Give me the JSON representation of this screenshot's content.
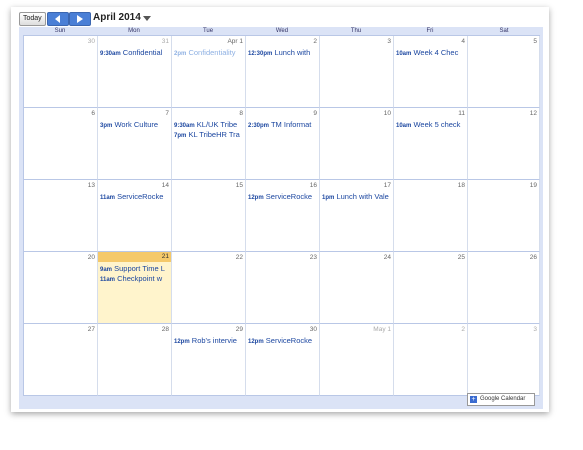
{
  "toolbar": {
    "today_label": "Today",
    "month_label": "April 2014"
  },
  "weekdays": [
    "Sun",
    "Mon",
    "Tue",
    "Wed",
    "Thu",
    "Fri",
    "Sat"
  ],
  "weeks": [
    [
      {
        "day": "30",
        "other": true,
        "events": []
      },
      {
        "day": "31",
        "other": true,
        "events": [
          {
            "time": "9:30am",
            "title": "Confidential"
          }
        ]
      },
      {
        "day": "Apr 1",
        "other": false,
        "events": [
          {
            "time": "2pm",
            "title": "Confidentiality",
            "faded": true
          }
        ]
      },
      {
        "day": "2",
        "other": false,
        "events": [
          {
            "time": "12:30pm",
            "title": "Lunch with"
          }
        ]
      },
      {
        "day": "3",
        "other": false,
        "events": []
      },
      {
        "day": "4",
        "other": false,
        "events": [
          {
            "time": "10am",
            "title": "Week 4 Chec"
          }
        ]
      },
      {
        "day": "5",
        "other": false,
        "events": []
      }
    ],
    [
      {
        "day": "6",
        "other": false,
        "events": []
      },
      {
        "day": "7",
        "other": false,
        "events": [
          {
            "time": "3pm",
            "title": "Work Culture"
          }
        ]
      },
      {
        "day": "8",
        "other": false,
        "events": [
          {
            "time": "9:30am",
            "title": "KL/UK Tribe"
          },
          {
            "time": "7pm",
            "title": "KL TribeHR Tra"
          }
        ]
      },
      {
        "day": "9",
        "other": false,
        "events": [
          {
            "time": "2:30pm",
            "title": "TM Informat"
          }
        ]
      },
      {
        "day": "10",
        "other": false,
        "events": []
      },
      {
        "day": "11",
        "other": false,
        "events": [
          {
            "time": "10am",
            "title": "Week 5 check"
          }
        ]
      },
      {
        "day": "12",
        "other": false,
        "events": []
      }
    ],
    [
      {
        "day": "13",
        "other": false,
        "events": []
      },
      {
        "day": "14",
        "other": false,
        "events": [
          {
            "time": "11am",
            "title": "ServiceRocke"
          }
        ]
      },
      {
        "day": "15",
        "other": false,
        "events": []
      },
      {
        "day": "16",
        "other": false,
        "events": [
          {
            "time": "12pm",
            "title": "ServiceRocke"
          }
        ]
      },
      {
        "day": "17",
        "other": false,
        "events": [
          {
            "time": "1pm",
            "title": "Lunch with Vale"
          }
        ]
      },
      {
        "day": "18",
        "other": false,
        "events": []
      },
      {
        "day": "19",
        "other": false,
        "events": []
      }
    ],
    [
      {
        "day": "20",
        "other": false,
        "events": []
      },
      {
        "day": "21",
        "other": false,
        "today": true,
        "events": [
          {
            "time": "9am",
            "title": "Support Time L"
          },
          {
            "time": "11am",
            "title": "Checkpoint w"
          }
        ]
      },
      {
        "day": "22",
        "other": false,
        "events": []
      },
      {
        "day": "23",
        "other": false,
        "events": []
      },
      {
        "day": "24",
        "other": false,
        "events": []
      },
      {
        "day": "25",
        "other": false,
        "events": []
      },
      {
        "day": "26",
        "other": false,
        "events": []
      }
    ],
    [
      {
        "day": "27",
        "other": false,
        "events": []
      },
      {
        "day": "28",
        "other": false,
        "events": []
      },
      {
        "day": "29",
        "other": false,
        "events": [
          {
            "time": "12pm",
            "title": "Rob's intervie"
          }
        ]
      },
      {
        "day": "30",
        "other": false,
        "events": [
          {
            "time": "12pm",
            "title": "ServiceRocke"
          }
        ]
      },
      {
        "day": "May 1",
        "other": true,
        "events": []
      },
      {
        "day": "2",
        "other": true,
        "events": []
      },
      {
        "day": "3",
        "other": true,
        "events": []
      }
    ]
  ],
  "footer": {
    "badge_label": "Google Calendar",
    "badge_icon": "plus-icon"
  },
  "colors": {
    "accent": "#4a7fd6",
    "event_text": "#1c47a0",
    "today_bg": "#fff4cc",
    "today_header": "#f5c96a",
    "header_bg": "#dbe3f6"
  }
}
